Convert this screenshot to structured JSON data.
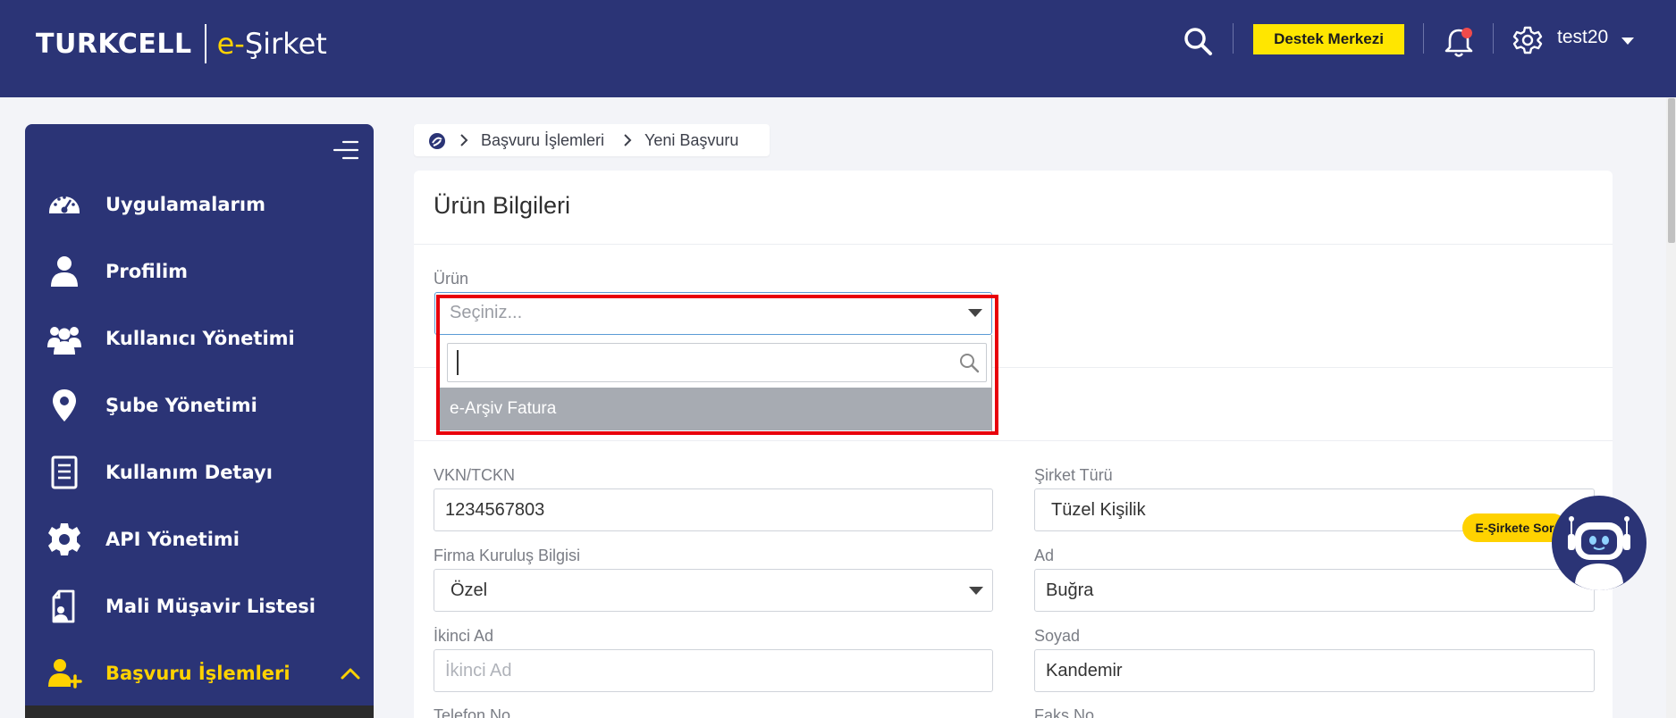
{
  "header": {
    "logo_brand": "TURKCELL",
    "logo_e": "e-",
    "logo_product": "Şirket",
    "support_button": "Destek Merkezi",
    "username": "test20",
    "bg_color": "#2b3476",
    "accent_color": "#ffd200"
  },
  "sidebar": {
    "items": [
      {
        "label": "Uygulamalarım",
        "icon": "dashboard-icon"
      },
      {
        "label": "Profilim",
        "icon": "user-icon"
      },
      {
        "label": "Kullanıcı Yönetimi",
        "icon": "users-icon"
      },
      {
        "label": "Şube Yönetimi",
        "icon": "location-pin-icon"
      },
      {
        "label": "Kullanım Detayı",
        "icon": "document-icon"
      },
      {
        "label": "API Yönetimi",
        "icon": "gear-icon"
      },
      {
        "label": "Mali Müşavir Listesi",
        "icon": "file-user-icon"
      },
      {
        "label": "Başvuru İşlemleri",
        "icon": "user-plus-icon",
        "active": true
      }
    ]
  },
  "breadcrumb": {
    "items": [
      "Başvuru İşlemleri",
      "Yeni Başvuru"
    ]
  },
  "form": {
    "title": "Ürün Bilgileri",
    "product_label": "Ürün",
    "product_placeholder": "Seçiniz...",
    "dropdown_search_value": "",
    "dropdown_options": [
      "e-Arşiv Fatura"
    ],
    "vkn_label": "VKN/TCKN",
    "vkn_value": "1234567803",
    "company_type_label": "Şirket Türü",
    "company_type_value": "Tüzel Kişilik",
    "founding_label": "Firma Kuruluş Bilgisi",
    "founding_value": "Özel",
    "first_name_label": "Ad",
    "first_name_value": "Buğra",
    "second_name_label": "İkinci Ad",
    "second_name_placeholder": "İkinci Ad",
    "surname_label": "Soyad",
    "surname_value": "Kandemir",
    "phone_label": "Telefon No",
    "fax_label": "Faks No"
  },
  "chatbot": {
    "label": "E-Şirkete Sor"
  }
}
